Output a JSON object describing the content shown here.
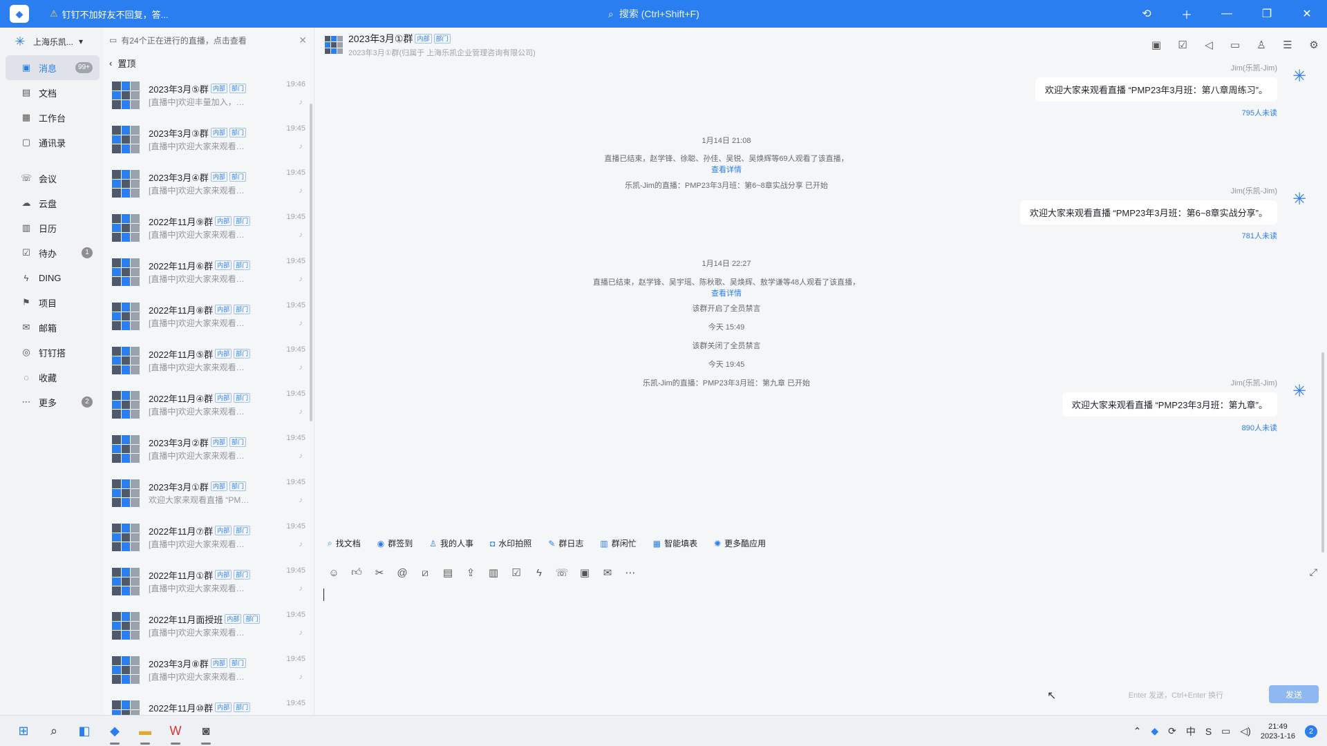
{
  "titlebar": {
    "notice": "钉钉不加好友不回复，答...",
    "search_placeholder": "搜索 (Ctrl+Shift+F)"
  },
  "nav": {
    "org": "上海乐凯...",
    "items": [
      {
        "label": "消息",
        "badge": "99+"
      },
      {
        "label": "文档",
        "badge": ""
      },
      {
        "label": "工作台",
        "badge": ""
      },
      {
        "label": "通讯录",
        "badge": ""
      },
      {
        "label": "会议",
        "badge": ""
      },
      {
        "label": "云盘",
        "badge": ""
      },
      {
        "label": "日历",
        "badge": ""
      },
      {
        "label": "待办",
        "badge": "1"
      },
      {
        "label": "DING",
        "badge": ""
      },
      {
        "label": "项目",
        "badge": ""
      },
      {
        "label": "邮箱",
        "badge": ""
      },
      {
        "label": "钉钉搭",
        "badge": ""
      },
      {
        "label": "收藏",
        "badge": ""
      },
      {
        "label": "更多",
        "badge": "2"
      }
    ]
  },
  "convlist": {
    "live_banner": "有24个正在进行的直播，点击查看",
    "pinned": "置顶",
    "tag_internal": "内部",
    "tag_dept": "部门",
    "items": [
      {
        "name": "2023年3月⑤群",
        "time": "19:46",
        "preview": "[直播中]欢迎丰量加入，群内共..."
      },
      {
        "name": "2023年3月③群",
        "time": "19:45",
        "preview": "[直播中]欢迎大家来观看直播 ..."
      },
      {
        "name": "2023年3月④群",
        "time": "19:45",
        "preview": "[直播中]欢迎大家来观看直播 ..."
      },
      {
        "name": "2022年11月⑨群",
        "time": "19:45",
        "preview": "[直播中]欢迎大家来观看直播 ..."
      },
      {
        "name": "2022年11月⑥群",
        "time": "19:45",
        "preview": "[直播中]欢迎大家来观看直播 ..."
      },
      {
        "name": "2022年11月⑧群",
        "time": "19:45",
        "preview": "[直播中]欢迎大家来观看直播 ..."
      },
      {
        "name": "2022年11月⑤群",
        "time": "19:45",
        "preview": "[直播中]欢迎大家来观看直播 ..."
      },
      {
        "name": "2022年11月④群",
        "time": "19:45",
        "preview": "[直播中]欢迎大家来观看直播 ..."
      },
      {
        "name": "2023年3月②群",
        "time": "19:45",
        "preview": "[直播中]欢迎大家来观看直播 ..."
      },
      {
        "name": "2023年3月①群",
        "time": "19:45",
        "preview": "欢迎大家来观看直播 “PMP23..."
      },
      {
        "name": "2022年11月⑦群",
        "time": "19:45",
        "preview": "[直播中]欢迎大家来观看直播 ..."
      },
      {
        "name": "2022年11月①群",
        "time": "19:45",
        "preview": "[直播中]欢迎大家来观看直播 ..."
      },
      {
        "name": "2022年11月面授班",
        "time": "19:45",
        "preview": "[直播中]欢迎大家来观看直播 ..."
      },
      {
        "name": "2023年3月⑧群",
        "time": "19:45",
        "preview": "[直播中]欢迎大家来观看直播 ..."
      },
      {
        "name": "2022年11月⑩群",
        "time": "19:45",
        "preview": ""
      }
    ]
  },
  "chat": {
    "title": "2023年3月①群",
    "subtitle": "2023年3月①群(归属于 上海乐凯企业管理咨询有限公司)",
    "sender": "Jim(乐凯-Jim)",
    "msg1": "欢迎大家来观看直播 “PMP23年3月班：第八章周练习”。",
    "msg1_unread": "795人未读",
    "time1": "1月14日 21:08",
    "sys1": "直播已结束，赵学锋、徐聪、孙佳、吴锐、吴焕辉等69人观看了该直播，",
    "view_details": "查看详情",
    "sys2": "乐凯-Jim的直播：PMP23年3月班：第6~8章实战分享 已开始",
    "msg2": "欢迎大家来观看直播 “PMP23年3月班：第6~8章实战分享”。",
    "msg2_unread": "781人未读",
    "time2": "1月14日 22:27",
    "sys3": "直播已结束，赵学锋、吴宇瑶、陈秋歌、吴焕辉、敖学谦等48人观看了该直播，",
    "sys4": "该群开启了全员禁言",
    "time3": "今天 15:49",
    "sys5": "该群关闭了全员禁言",
    "time4": "今天 19:45",
    "sys6": "乐凯-Jim的直播：PMP23年3月班：第九章 已开始",
    "msg3": "欢迎大家来观看直播 “PMP23年3月班：第九章”。",
    "msg3_unread": "890人未读",
    "apps": [
      "找文档",
      "群签到",
      "我的人事",
      "水印拍照",
      "群日志",
      "群闲忙",
      "智能填表",
      "更多酷应用"
    ],
    "send_hint": "Enter 发送，Ctrl+Enter 换行",
    "send": "发送"
  },
  "taskbar": {
    "time": "21:49",
    "date": "2023-1-16",
    "ime": "中",
    "notifications": "2"
  }
}
